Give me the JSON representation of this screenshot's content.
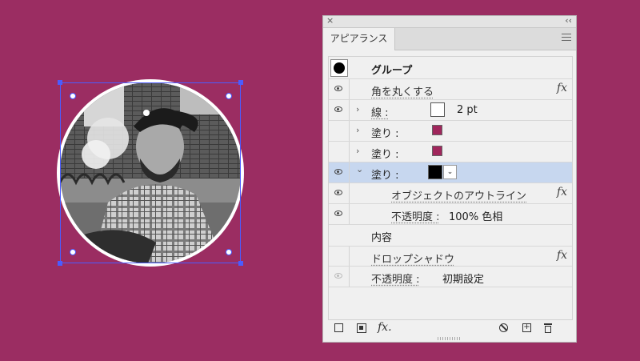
{
  "panel": {
    "tab_label": "アピアランス",
    "close_glyph": "×",
    "collapse_glyph": "‹‹"
  },
  "rows": {
    "group_label": "グループ",
    "round_corners": "角を丸くする",
    "stroke_label": "線 :",
    "stroke_weight": "2 pt",
    "fill1_label": "塗り :",
    "fill2_label": "塗り :",
    "fill3_label": "塗り :",
    "outline_object": "オブジェクトのアウトライン",
    "opacity_inner_label": "不透明度 :",
    "opacity_inner_value": "100% 色相",
    "contents_label": "内容",
    "drop_shadow": "ドロップシャドウ",
    "opacity_outer_label": "不透明度 :",
    "opacity_outer_value": "初期設定",
    "fx_glyph": "fx",
    "chevron_right": "›",
    "chevron_down": "⌄"
  },
  "colors": {
    "canvas_bg": "#9b2d62",
    "fill_swatch": "#a0265c",
    "fill_black": "#000000",
    "selection": "#4b5cff",
    "selected_row": "#c7d7ef"
  },
  "footer": {
    "fx_label": "fx."
  }
}
